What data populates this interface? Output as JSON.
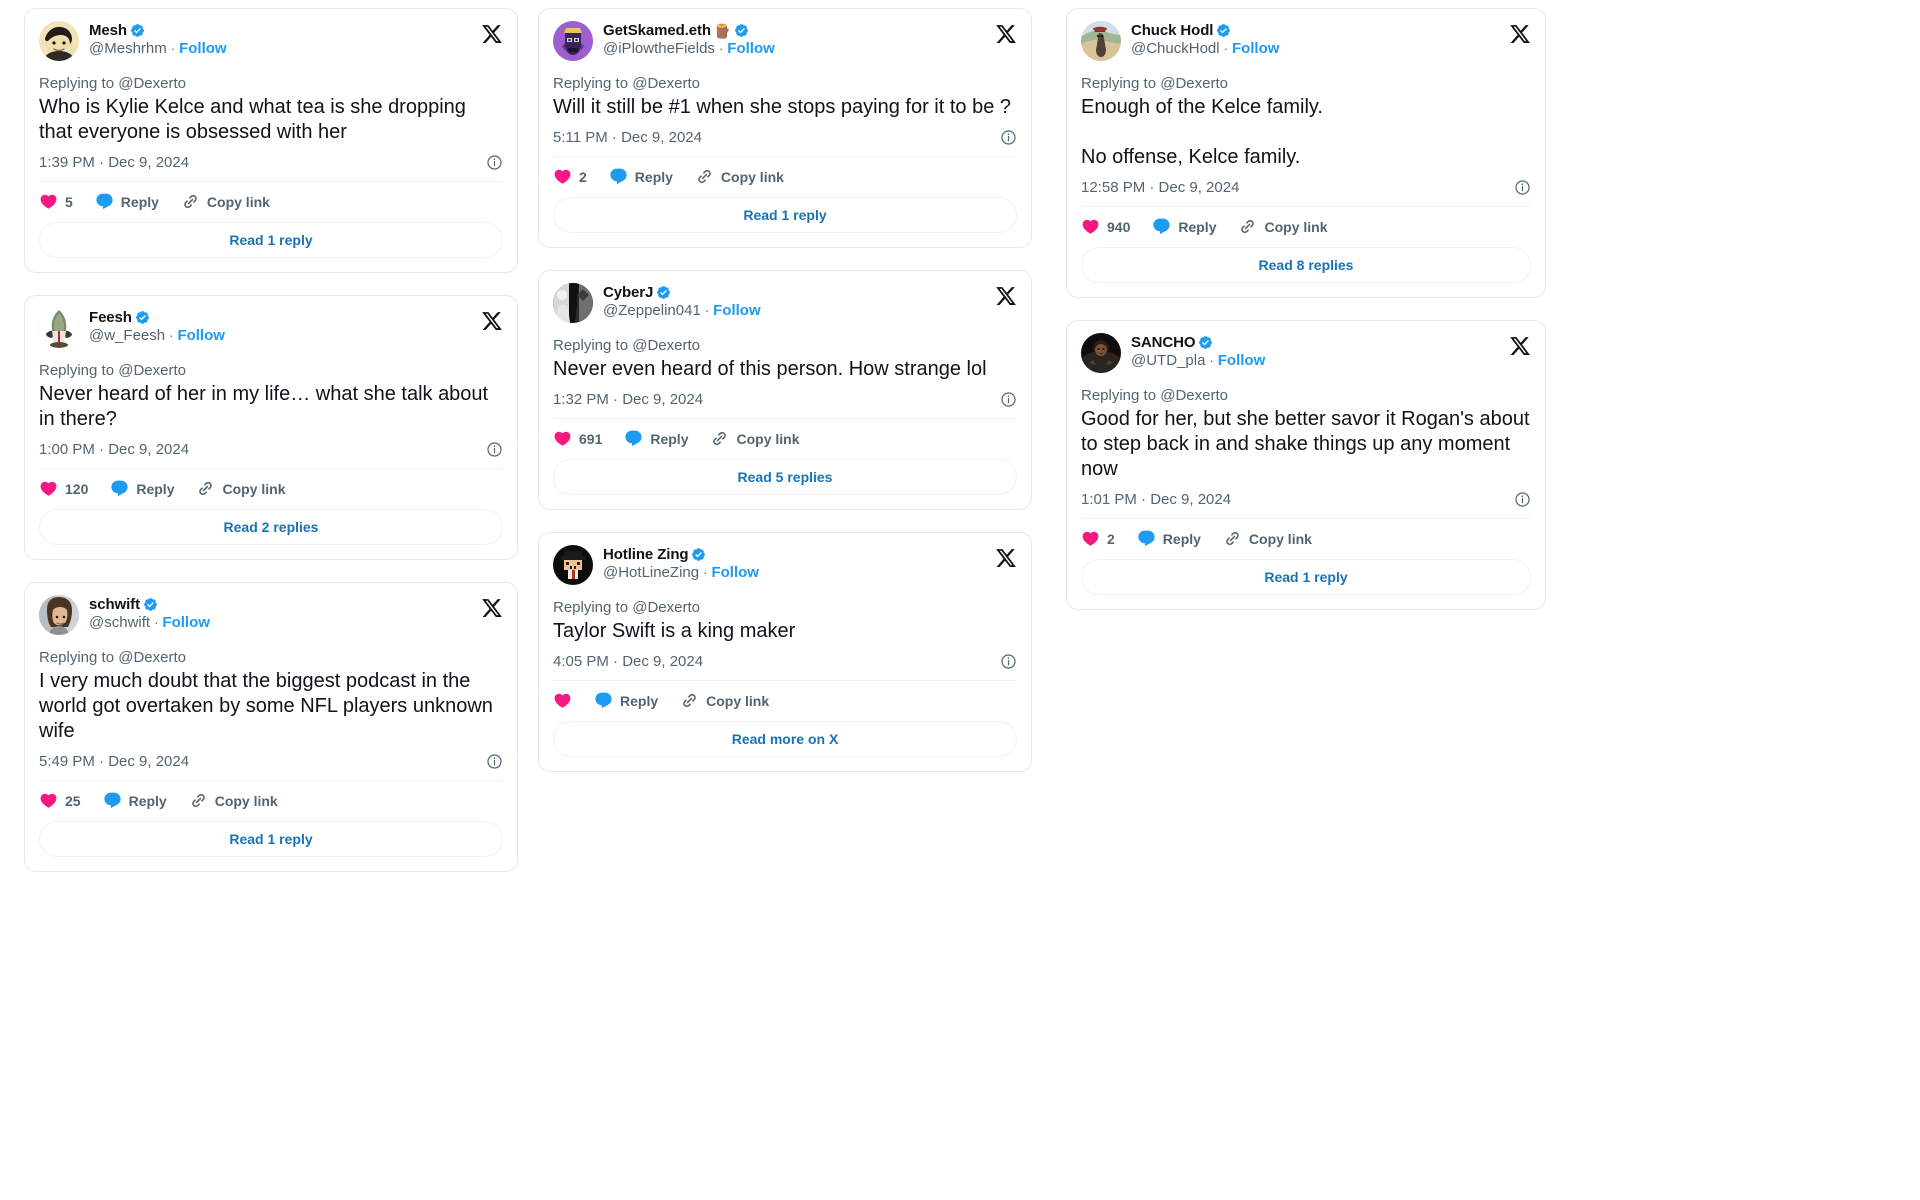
{
  "colors": {
    "accent_blue": "#1d9bf0",
    "link_blue": "#1a73b5",
    "like_pink": "#f91880",
    "muted_gray": "#536471",
    "text_black": "#0f1419",
    "card_border": "#e6e7e8"
  },
  "labels": {
    "reply": "Reply",
    "copy_link": "Copy link",
    "follow": "Follow",
    "separator": "·"
  },
  "icons": {
    "x_logo": "x-logo-icon",
    "verified": "verified-badge-icon",
    "heart": "heart-icon",
    "reply_bubble": "reply-bubble-icon",
    "copy_link": "link-chain-icon",
    "info": "info-circle-icon"
  },
  "columns": [
    {
      "index": 0,
      "tweets": [
        {
          "display_name": "Mesh",
          "name_emoji": "",
          "verified": true,
          "handle": "@Meshrhm",
          "follow_label": "Follow",
          "replying_to": "Replying to @Dexerto",
          "text": "Who is Kylie Kelce and what tea is she dropping that everyone is obsessed with her",
          "timestamp": "1:39 PM · Dec 9, 2024",
          "likes": "5",
          "reply_label": "Reply",
          "copy_label": "Copy link",
          "read_more": "Read 1 reply",
          "avatar_style": "mesh"
        },
        {
          "display_name": "Feesh",
          "name_emoji": "",
          "verified": true,
          "handle": "@w_Feesh",
          "follow_label": "Follow",
          "replying_to": "Replying to @Dexerto",
          "text": "Never heard of her in my life… what she talk about in there?",
          "timestamp": "1:00 PM · Dec 9, 2024",
          "likes": "120",
          "reply_label": "Reply",
          "copy_label": "Copy link",
          "read_more": "Read 2 replies",
          "avatar_style": "feesh"
        },
        {
          "display_name": "schwift",
          "name_emoji": "",
          "verified": true,
          "handle": "@schwift",
          "follow_label": "Follow",
          "replying_to": "Replying to @Dexerto",
          "text": "I very much doubt that the biggest podcast in the world got overtaken by some NFL players unknown wife",
          "timestamp": "5:49 PM · Dec 9, 2024",
          "likes": "25",
          "reply_label": "Reply",
          "copy_label": "Copy link",
          "read_more": "Read 1 reply",
          "avatar_style": "schwift"
        }
      ]
    },
    {
      "index": 1,
      "tweets": [
        {
          "display_name": "GetSkamed.eth",
          "name_emoji": "🪵",
          "verified": true,
          "handle": "@iPlowtheFields",
          "follow_label": "Follow",
          "replying_to": "Replying to @Dexerto",
          "text": "Will it still be #1 when she stops paying for it to be ?",
          "timestamp": "5:11 PM · Dec 9, 2024",
          "likes": "2",
          "reply_label": "Reply",
          "copy_label": "Copy link",
          "read_more": "Read 1 reply",
          "avatar_style": "skamed"
        },
        {
          "display_name": "CyberJ",
          "name_emoji": "",
          "verified": true,
          "handle": "@Zeppelin041",
          "follow_label": "Follow",
          "replying_to": "Replying to @Dexerto",
          "text": "Never even heard of this person. How strange lol",
          "timestamp": "1:32 PM · Dec 9, 2024",
          "likes": "691",
          "reply_label": "Reply",
          "copy_label": "Copy link",
          "read_more": "Read 5 replies",
          "avatar_style": "cyberj"
        },
        {
          "display_name": "Hotline Zing",
          "name_emoji": "",
          "verified": true,
          "handle": "@HotLineZing",
          "follow_label": "Follow",
          "replying_to": "Replying to @Dexerto",
          "text": "Taylor Swift is a king maker",
          "timestamp": "4:05 PM · Dec 9, 2024",
          "likes": "",
          "reply_label": "Reply",
          "copy_label": "Copy link",
          "read_more": "Read more on X",
          "avatar_style": "hotline"
        }
      ]
    },
    {
      "index": 2,
      "tweets": [
        {
          "display_name": "Chuck Hodl",
          "name_emoji": "",
          "verified": true,
          "handle": "@ChuckHodl",
          "follow_label": "Follow",
          "replying_to": "Replying to @Dexerto",
          "text": "Enough of the Kelce family.\n\nNo offense, Kelce family.",
          "timestamp": "12:58 PM · Dec 9, 2024",
          "likes": "940",
          "reply_label": "Reply",
          "copy_label": "Copy link",
          "read_more": "Read 8 replies",
          "avatar_style": "chuck"
        },
        {
          "display_name": "SANCHO",
          "name_emoji": "",
          "verified": true,
          "handle": "@UTD_pla",
          "follow_label": "Follow",
          "replying_to": "Replying to @Dexerto",
          "text": "Good for her, but she better savor it Rogan's about to step back in and shake things up any moment now",
          "timestamp": "1:01 PM · Dec 9, 2024",
          "likes": "2",
          "reply_label": "Reply",
          "copy_label": "Copy link",
          "read_more": "Read 1 reply",
          "avatar_style": "sancho"
        }
      ]
    }
  ]
}
